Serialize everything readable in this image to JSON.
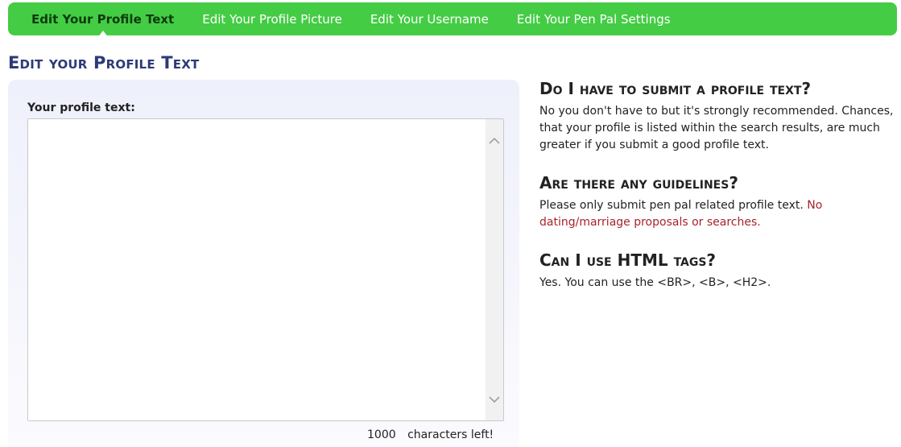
{
  "nav": {
    "items": [
      {
        "label": "Edit Your Profile Text",
        "active": true
      },
      {
        "label": "Edit Your Profile Picture",
        "active": false
      },
      {
        "label": "Edit Your Username",
        "active": false
      },
      {
        "label": "Edit Your Pen Pal Settings",
        "active": false
      }
    ]
  },
  "page_title": "Edit your Profile Text",
  "form": {
    "label": "Your profile text:",
    "textarea_value": "",
    "chars_left": "1000",
    "chars_left_suffix": "characters left!"
  },
  "faq": [
    {
      "question": "Do I have to submit a profile text?",
      "answer": "No you don't have to but it's strongly recommended. Chances, that your profile is listed within the search results, are much greater if you submit a good profile text."
    },
    {
      "question": "Are there any guidelines?",
      "answer": "Please only submit pen pal related profile text.",
      "warning": "No dating/marriage proposals or searches."
    },
    {
      "question": "Can I use HTML tags?",
      "answer": "Yes. You can use the <BR>, <B>, <H2>."
    }
  ],
  "colors": {
    "nav_bg": "#44cc44",
    "title": "#2d3a78",
    "warning": "#a8232b"
  },
  "icons": {
    "scroll_up": "chevron-up-icon",
    "scroll_down": "chevron-down-icon"
  }
}
